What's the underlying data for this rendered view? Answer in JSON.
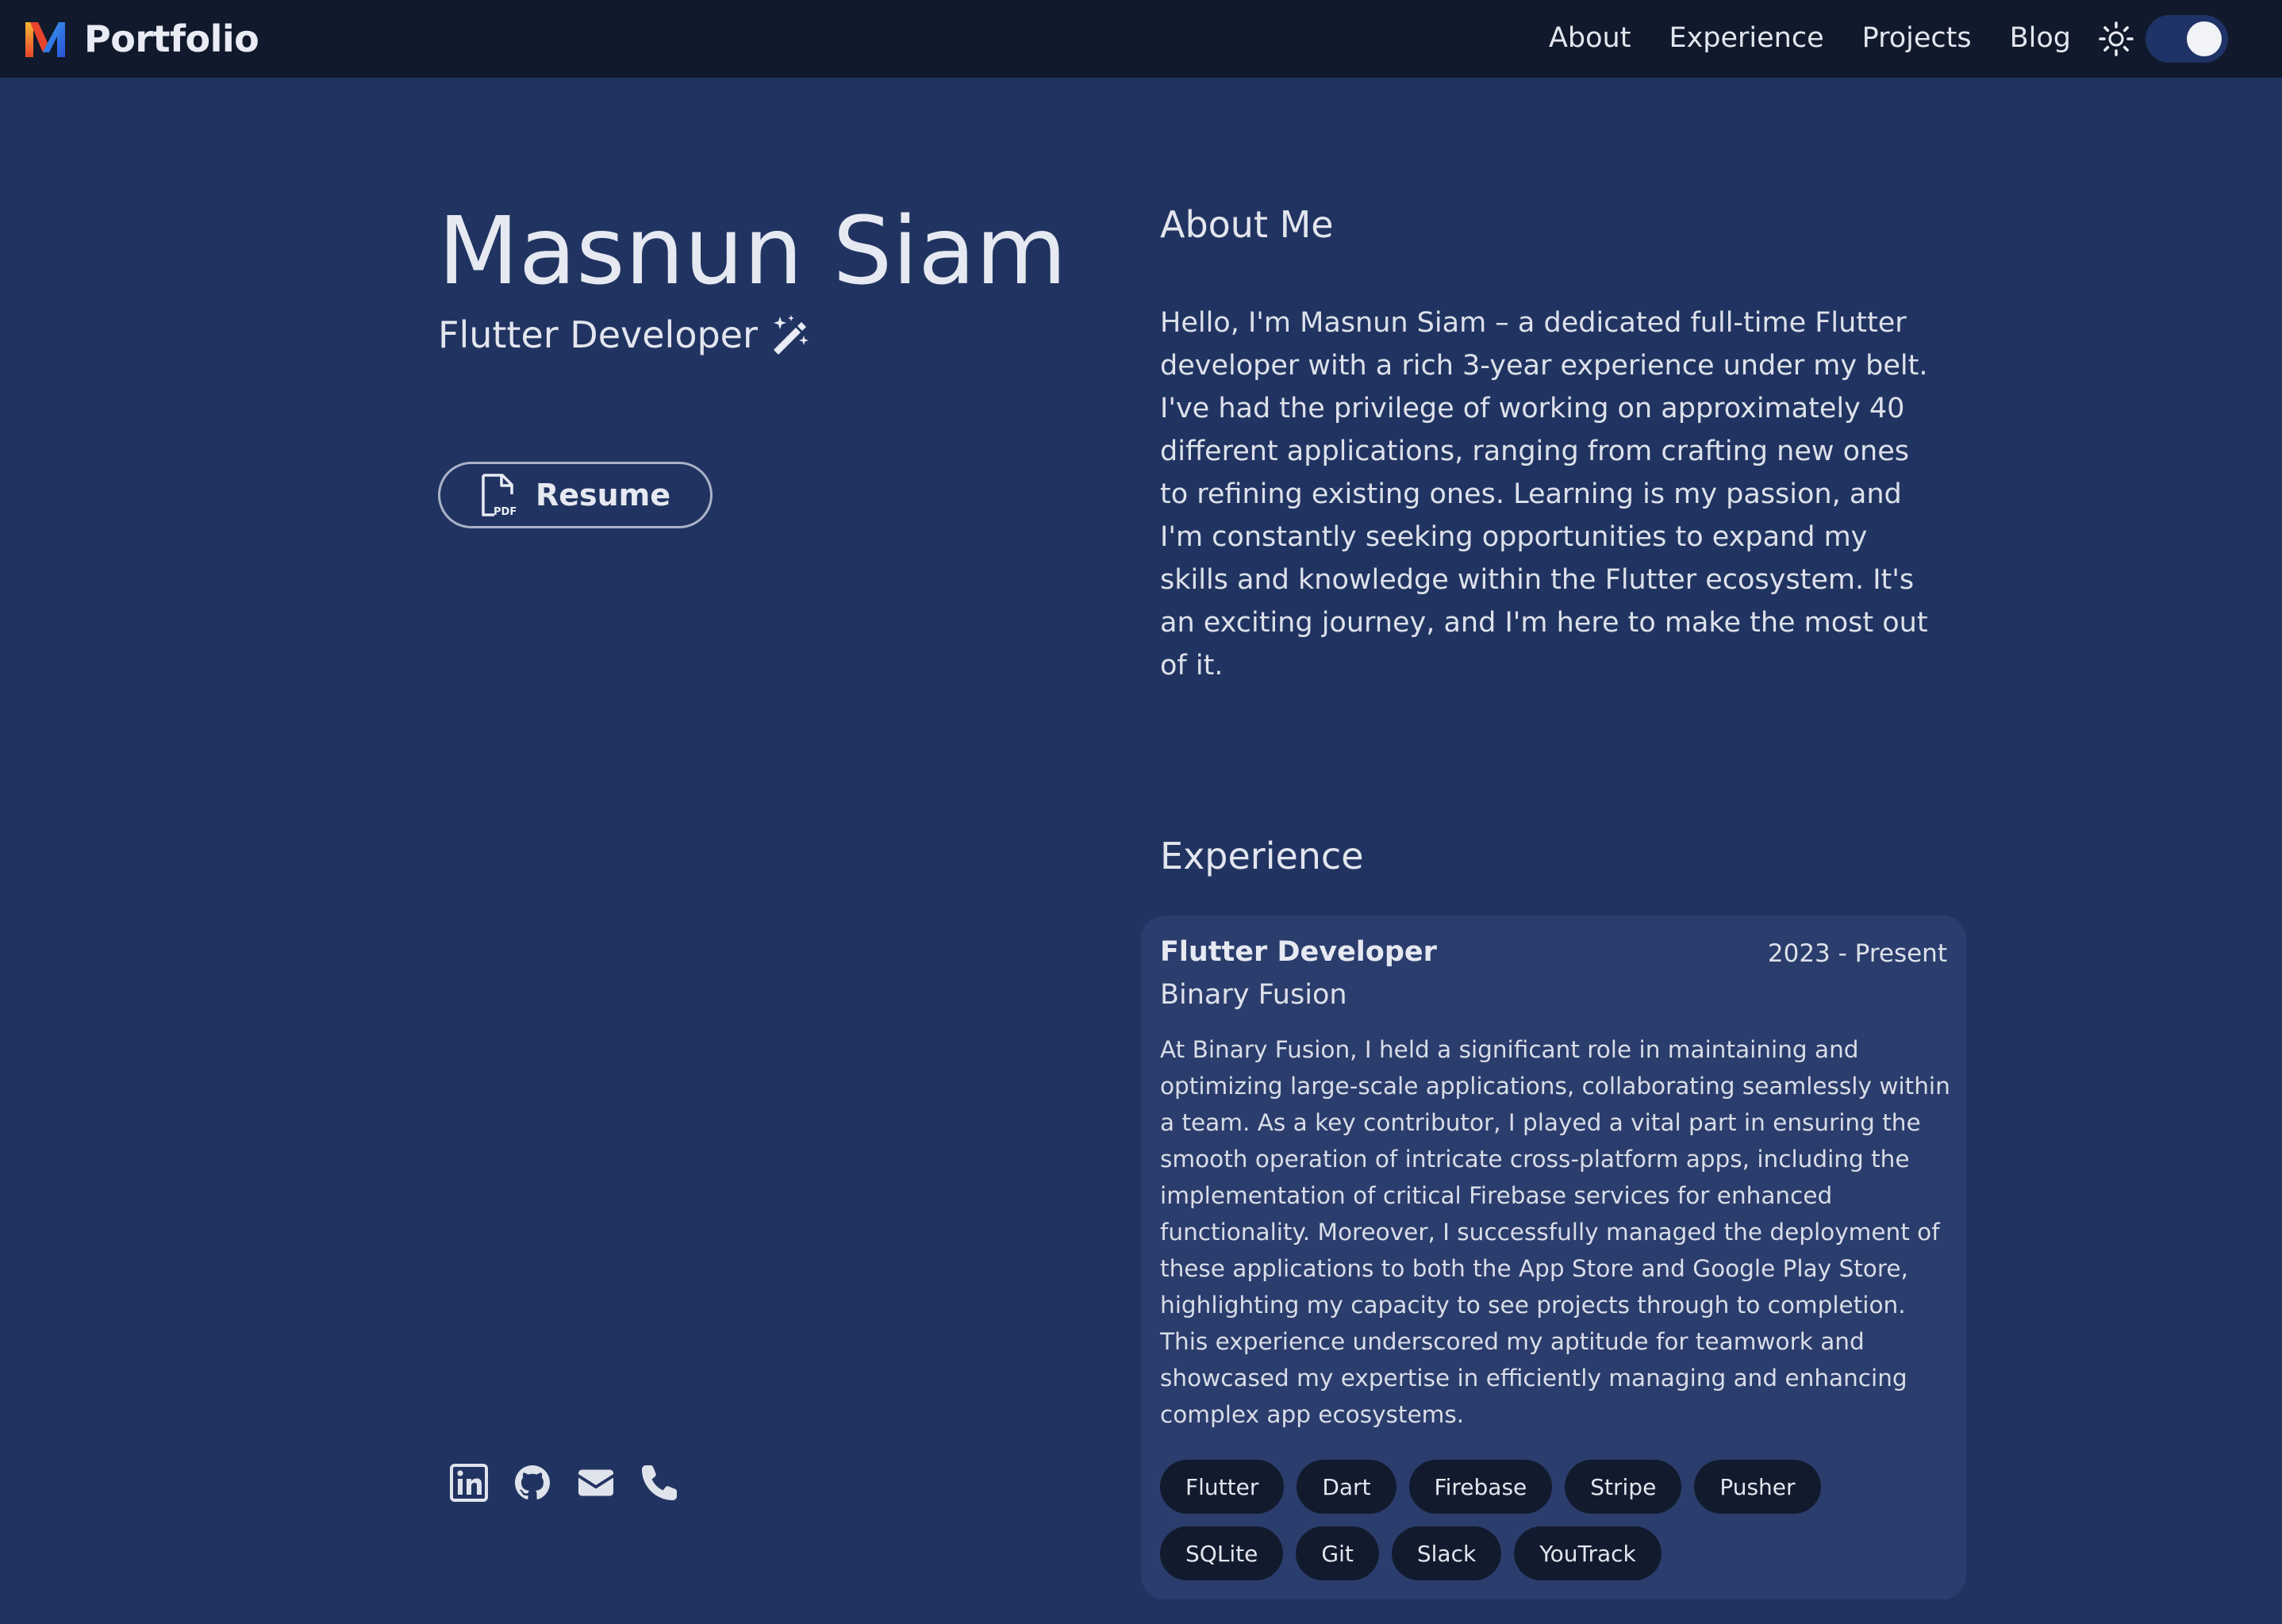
{
  "navbar": {
    "brand": "Portfolio",
    "links": [
      "About",
      "Experience",
      "Projects",
      "Blog"
    ],
    "theme": {
      "mode": "dark"
    }
  },
  "hero": {
    "name": "Masnun Siam",
    "role": "Flutter Developer",
    "resume_label": "Resume"
  },
  "socials": [
    "linkedin-icon",
    "github-icon",
    "email-icon",
    "phone-icon"
  ],
  "about": {
    "title": "About Me",
    "text": "Hello, I'm Masnun Siam – a dedicated full-time Flutter developer with a rich 3-year experience under my belt. I've had the privilege of working on approximately 40 different applications, ranging from crafting new ones to refining existing ones. Learning is my passion, and I'm constantly seeking opportunities to expand my skills and knowledge within the Flutter ecosystem. It's an exciting journey, and I'm here to make the most out of it."
  },
  "experience": {
    "title": "Experience",
    "jobs": [
      {
        "title": "Flutter Developer",
        "dates": "2023 - Present",
        "company": "Binary Fusion",
        "description": "At Binary Fusion, I held a significant role in maintaining and optimizing large-scale applications, collaborating seamlessly within a team. As a key contributor, I played a vital part in ensuring the smooth operation of intricate cross-platform apps, including the implementation of critical Firebase services for enhanced functionality. Moreover, I successfully managed the deployment of these applications to both the App Store and Google Play Store, highlighting my capacity to see projects through to completion. This experience underscored my aptitude for teamwork and showcased my expertise in efficiently managing and enhancing complex app ecosystems.",
        "tags": [
          "Flutter",
          "Dart",
          "Firebase",
          "Stripe",
          "Pusher",
          "SQLite",
          "Git",
          "Slack",
          "YouTrack"
        ]
      }
    ]
  },
  "colors": {
    "background": "#213461",
    "navbar": "#111a2c",
    "card": "#2b3d6c",
    "tag": "#121b2e",
    "text": "#e3e6ee"
  }
}
